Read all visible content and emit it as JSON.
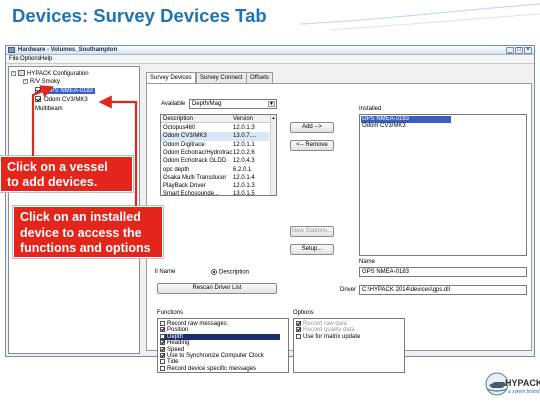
{
  "slide": {
    "title": "Devices:  Survey Devices Tab"
  },
  "window": {
    "title": "Hardware - Volumes_Southampton",
    "menus": [
      "File",
      "Options",
      "Help"
    ],
    "controls": [
      "_",
      "□",
      "×"
    ]
  },
  "tree": {
    "root": "HYPACK Configuration",
    "vessel": "R/V Smoky",
    "devices": [
      "GPS NMEA-0183",
      "Odom CV3/MK3"
    ],
    "other": "Multibeam"
  },
  "tabs": [
    "Survey Devices",
    "Survey Connect",
    "Offsets"
  ],
  "available": {
    "label": "Available",
    "filter_value": "Depth/Mag",
    "columns": [
      "Description",
      "Version"
    ],
    "rows": [
      {
        "description": "Octopus460",
        "version": "12.0.1.3"
      },
      {
        "description": "Odom CV3/MK3",
        "version": "13.0.7...."
      },
      {
        "description": "Odom Digitrace",
        "version": "12.0.1.1"
      },
      {
        "description": "Odom Echotrac/Hydrotrac",
        "version": "12.0.2.6"
      },
      {
        "description": "Odom Echotrack GLDD",
        "version": "12.0.4.3"
      },
      {
        "description": "opc depth",
        "version": "6.2.0.1"
      },
      {
        "description": "Osaka Multi Transducer",
        "version": "12.0.1.4"
      },
      {
        "description": "PlayBack Driver",
        "version": "12.0.1.3"
      },
      {
        "description": "Smart Echosounde...",
        "version": "13.0.1.5"
      }
    ],
    "sort_label": "ll Name",
    "sort_option": "Description",
    "rescan_button": "Rescan Driver List"
  },
  "buttons": {
    "add": "Add -->",
    "remove": "<-- Remove",
    "new_stations": "New Stations...",
    "setup": "Setup..."
  },
  "installed": {
    "label": "Installed",
    "items": [
      "GPS NMEA-0183",
      "Odom CV3/MK3"
    ],
    "name_label": "Name",
    "name_value": "GPS NMEA-0183",
    "driver_label": "Driver",
    "driver_value": "C:\\HYPACK 2014\\devices\\gps.dll"
  },
  "functions": {
    "label": "Functions",
    "items": [
      {
        "label": "Record raw messages",
        "checked": false
      },
      {
        "label": "Position",
        "checked": true
      },
      {
        "label": "Depth",
        "checked": false
      },
      {
        "label": "Heading",
        "checked": true
      },
      {
        "label": "Speed",
        "checked": true
      },
      {
        "label": "Use to Synchronize Computer Clock",
        "checked": true
      },
      {
        "label": "Tide",
        "checked": false
      },
      {
        "label": "Record device specific messages",
        "checked": false
      }
    ]
  },
  "options": {
    "label": "Options",
    "items": [
      {
        "label": "Record raw data",
        "checked": true
      },
      {
        "label": "Record quality data",
        "checked": true
      },
      {
        "label": "Use for matrix update",
        "checked": false
      }
    ]
  },
  "callouts": {
    "vessel": "Click on a vessel to add devices.",
    "vessel_lines": [
      "Click on a vessel",
      "to add devices."
    ],
    "installed_lines": [
      "Click on an installed",
      "device to access the",
      "functions and options"
    ]
  },
  "logo": {
    "name": "HYPACK",
    "tagline": "a xylem brand"
  },
  "colors": {
    "title_blue": "#1f73b7",
    "callout_red": "#e3251b",
    "selection_blue": "#3b5fc0"
  }
}
